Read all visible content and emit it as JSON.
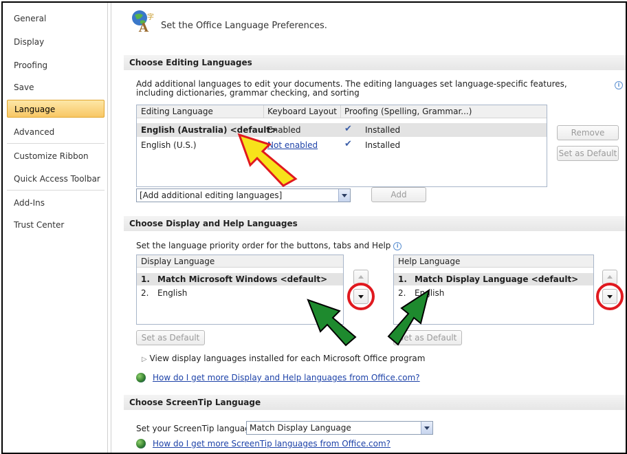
{
  "sidebar": {
    "items": [
      {
        "label": "General"
      },
      {
        "label": "Display"
      },
      {
        "label": "Proofing"
      },
      {
        "label": "Save"
      },
      {
        "label": "Language"
      },
      {
        "label": "Advanced"
      },
      {
        "label": "Customize Ribbon"
      },
      {
        "label": "Quick Access Toolbar"
      },
      {
        "label": "Add-Ins"
      },
      {
        "label": "Trust Center"
      }
    ],
    "active_item": "Language"
  },
  "page": {
    "title": "Set the Office Language Preferences."
  },
  "editing": {
    "header": "Choose Editing Languages",
    "description": "Add additional languages to edit your documents. The editing languages set language-specific features, including dictionaries, grammar checking, and sorting",
    "columns": [
      "Editing Language",
      "Keyboard Layout",
      "Proofing (Spelling, Grammar...)"
    ],
    "rows": [
      {
        "language": "English (Australia) <default>",
        "keyboard": "Enabled",
        "proofing": "Installed"
      },
      {
        "language": "English (U.S.)",
        "keyboard": "Not enabled",
        "proofing": "Installed"
      }
    ],
    "remove_label": "Remove",
    "set_default_label": "Set as Default",
    "add_combo_value": "[Add additional editing languages]",
    "add_label": "Add"
  },
  "display_help": {
    "header": "Choose Display and Help Languages",
    "description": "Set the language priority order for the buttons, tabs and Help",
    "display_header": "Display Language",
    "display_items": [
      {
        "num": "1.",
        "label": "Match Microsoft Windows <default>"
      },
      {
        "num": "2.",
        "label": "English"
      }
    ],
    "help_header": "Help Language",
    "help_items": [
      {
        "num": "1.",
        "label": "Match Display Language <default>"
      },
      {
        "num": "2.",
        "label": "English"
      }
    ],
    "display_set_default": "Set as Default",
    "help_set_default": "Set as Default",
    "view_installed": "View display languages installed for each Microsoft Office program",
    "more_link": "How do I get more Display and Help languages from Office.com?"
  },
  "screentip": {
    "header": "Choose ScreenTip Language",
    "label": "Set your ScreenTip language",
    "combo_value": "Match Display Language",
    "more_link": "How do I get more ScreenTip languages from Office.com?"
  },
  "colors": {
    "active_nav": "#f8c765",
    "annotation_red": "#e0191f",
    "annotation_green": "#1e8a2e",
    "annotation_yellow": "#f7e21a"
  }
}
